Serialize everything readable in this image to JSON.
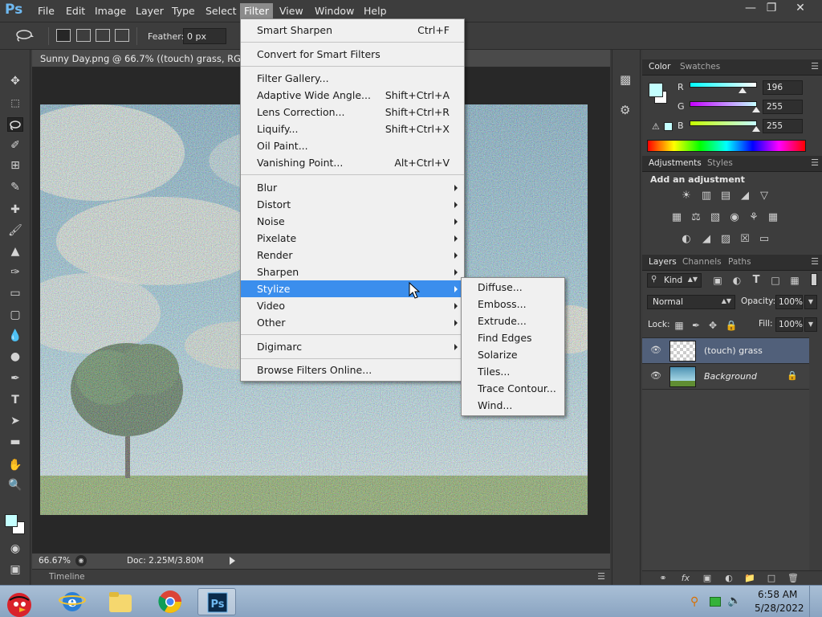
{
  "app": {
    "logo": "Ps",
    "menu": [
      "File",
      "Edit",
      "Image",
      "Layer",
      "Type",
      "Select",
      "Filter",
      "View",
      "Window",
      "Help"
    ],
    "active_menu": "Filter"
  },
  "options_bar": {
    "feather_label": "Feather:",
    "feather_value": "0 px"
  },
  "document": {
    "tab_title": "Sunny Day.png @ 66.7% ((touch) grass, RGB/8)",
    "zoom": "66.67%",
    "doc_info": "Doc: 2.25M/3.80M",
    "timeline_label": "Timeline"
  },
  "filter_menu": {
    "items": [
      {
        "label": "Smart Sharpen",
        "shortcut": "Ctrl+F"
      },
      {
        "separator": true
      },
      {
        "label": "Convert for Smart Filters"
      },
      {
        "separator": true
      },
      {
        "label": "Filter Gallery..."
      },
      {
        "label": "Adaptive Wide Angle...",
        "shortcut": "Shift+Ctrl+A"
      },
      {
        "label": "Lens Correction...",
        "shortcut": "Shift+Ctrl+R"
      },
      {
        "label": "Liquify...",
        "shortcut": "Shift+Ctrl+X"
      },
      {
        "label": "Oil Paint..."
      },
      {
        "label": "Vanishing Point...",
        "shortcut": "Alt+Ctrl+V"
      },
      {
        "separator": true
      },
      {
        "label": "Blur",
        "submenu": true
      },
      {
        "label": "Distort",
        "submenu": true
      },
      {
        "label": "Noise",
        "submenu": true
      },
      {
        "label": "Pixelate",
        "submenu": true
      },
      {
        "label": "Render",
        "submenu": true
      },
      {
        "label": "Sharpen",
        "submenu": true
      },
      {
        "label": "Stylize",
        "submenu": true,
        "highlighted": true
      },
      {
        "label": "Video",
        "submenu": true
      },
      {
        "label": "Other",
        "submenu": true
      },
      {
        "separator": true
      },
      {
        "label": "Digimarc",
        "submenu": true
      },
      {
        "separator": true
      },
      {
        "label": "Browse Filters Online..."
      }
    ]
  },
  "stylize_submenu": {
    "items": [
      "Diffuse...",
      "Emboss...",
      "Extrude...",
      "Find Edges",
      "Solarize",
      "Tiles...",
      "Trace Contour...",
      "Wind..."
    ]
  },
  "color_panel": {
    "tabs": [
      "Color",
      "Swatches"
    ],
    "foreground": "#c4ffff",
    "channels": [
      {
        "name": "R",
        "value": "196"
      },
      {
        "name": "G",
        "value": "255"
      },
      {
        "name": "B",
        "value": "255"
      }
    ]
  },
  "adjustments_panel": {
    "tabs": [
      "Adjustments",
      "Styles"
    ],
    "heading": "Add an adjustment"
  },
  "layers_panel": {
    "tabs": [
      "Layers",
      "Channels",
      "Paths"
    ],
    "filter_kind": "Kind",
    "blend_mode": "Normal",
    "opacity_label": "Opacity:",
    "opacity_value": "100%",
    "lock_label": "Lock:",
    "fill_label": "Fill:",
    "fill_value": "100%",
    "layers": [
      {
        "name": "(touch) grass",
        "selected": true
      },
      {
        "name": "Background",
        "locked": true
      }
    ]
  },
  "taskbar": {
    "time": "6:58 AM",
    "date": "5/28/2022"
  },
  "colors": {
    "menu_highlight": "#3b8eed",
    "ps_blue": "#6fb9f1",
    "selected_layer": "#51607a"
  }
}
